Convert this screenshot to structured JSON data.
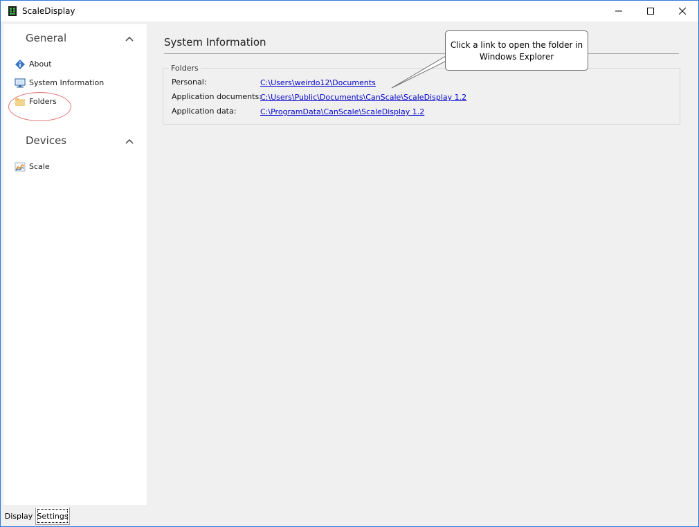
{
  "window": {
    "title": "ScaleDisplay",
    "icon": "scale-app-icon"
  },
  "sidebar": {
    "sections": [
      {
        "title": "General",
        "items": [
          {
            "label": "About",
            "icon": "info-icon"
          },
          {
            "label": "System Information",
            "icon": "computer-icon"
          },
          {
            "label": "Folders",
            "icon": "folder-icon"
          }
        ]
      },
      {
        "title": "Devices",
        "items": [
          {
            "label": "Scale",
            "icon": "chart-icon"
          }
        ]
      }
    ]
  },
  "main": {
    "title": "System Information",
    "groupbox": {
      "legend": "Folders",
      "rows": [
        {
          "label": "Personal:",
          "link": "C:\\Users\\weirdo12\\Documents"
        },
        {
          "label": "Application documents:",
          "link": "C:\\Users\\Public\\Documents\\CanScale\\ScaleDisplay 1.2"
        },
        {
          "label": "Application data:",
          "link": "C:\\ProgramData\\CanScale\\ScaleDisplay 1.2"
        }
      ]
    },
    "callout": {
      "line1": "Click a link to open the folder in",
      "line2": "Windows Explorer"
    }
  },
  "tabs": [
    {
      "label": "Display"
    },
    {
      "label": "Settings"
    }
  ],
  "colors": {
    "window_border": "#2b79d8",
    "link": "#0000cc",
    "highlight": "#e57373"
  }
}
